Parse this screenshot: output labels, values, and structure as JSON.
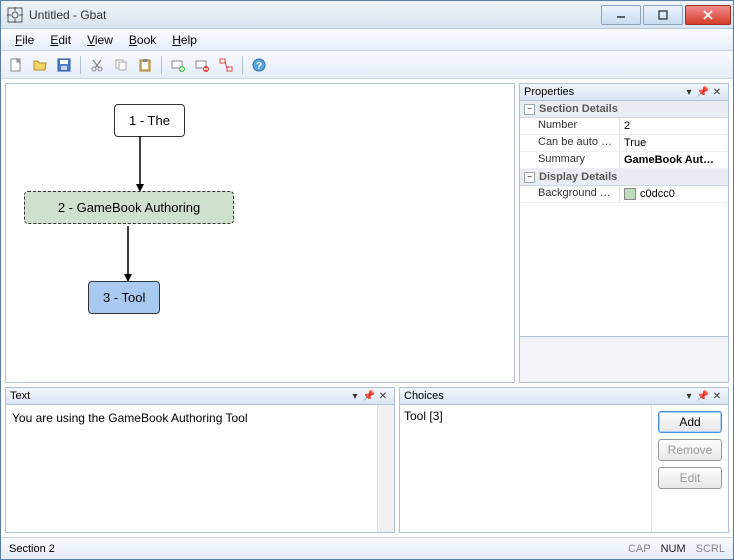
{
  "window": {
    "title": "Untitled - Gbat"
  },
  "menubar": {
    "file": "File",
    "edit": "Edit",
    "view": "View",
    "book": "Book",
    "help": "Help"
  },
  "nodes": {
    "n1": "1 - The",
    "n2": "2 - GameBook Authoring",
    "n3": "3 - Tool"
  },
  "panels": {
    "properties": "Properties",
    "text": "Text",
    "choices": "Choices"
  },
  "properties": {
    "section_details": "Section Details",
    "number_label": "Number",
    "number_value": "2",
    "can_label": "Can be auto s…",
    "can_value": "True",
    "summary_label": "Summary",
    "summary_value": "GameBook Aut…",
    "display_details": "Display Details",
    "bgcolor_label": "Background C…",
    "bgcolor_value": "c0dcc0",
    "bgcolor_hex": "#c0dcc0"
  },
  "text_panel": {
    "content": "You are using the GameBook Authoring Tool"
  },
  "choices_panel": {
    "item": "Tool [3]",
    "add": "Add",
    "remove": "Remove",
    "edit": "Edit"
  },
  "statusbar": {
    "left": "Section 2",
    "cap": "CAP",
    "num": "NUM",
    "scrl": "SCRL"
  }
}
